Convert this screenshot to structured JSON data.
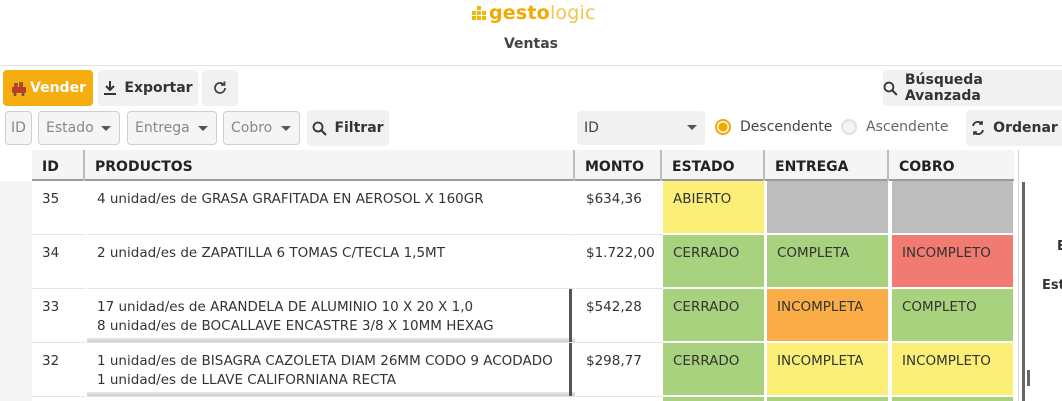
{
  "app": {
    "logo_bold": "gesto",
    "logo_light": "logic",
    "page_title": "Ventas"
  },
  "toolbar": {
    "sell_label": "Vender",
    "export_label": "Exportar",
    "advanced_search_label": "Búsqueda Avanzada"
  },
  "filters": {
    "id_placeholder": "ID",
    "estado_placeholder": "Estado",
    "entrega_placeholder": "Entrega",
    "cobro_placeholder": "Cobro",
    "filter_label": "Filtrar",
    "sort_field": "ID",
    "sort_desc_label": "Descendente",
    "sort_asc_label": "Ascendente",
    "sort_desc_selected": true,
    "order_label": "Ordenar"
  },
  "table": {
    "headers": {
      "id": "ID",
      "productos": "PRODUCTOS",
      "monto": "MONTO",
      "estado": "ESTADO",
      "entrega": "ENTREGA",
      "cobro": "COBRO"
    },
    "rows": [
      {
        "id": "35",
        "productos": [
          "4 unidad/es de GRASA GRAFITADA EN AEROSOL X 160GR"
        ],
        "monto": "$634,36",
        "estado": "ABIERTO",
        "entrega": "",
        "cobro": ""
      },
      {
        "id": "34",
        "productos": [
          "2 unidad/es de ZAPATILLA 6 TOMAS C/TECLA 1,5MT"
        ],
        "monto": "$1.722,00",
        "estado": "CERRADO",
        "entrega": "COMPLETA",
        "cobro": "INCOMPLETO"
      },
      {
        "id": "33",
        "productos": [
          "17 unidad/es de ARANDELA DE ALUMINIO 10 X 20 X 1,0",
          "8 unidad/es de BOCALLAVE ENCASTRE 3/8 X 10MM HEXAG"
        ],
        "monto": "$542,28",
        "estado": "CERRADO",
        "entrega": "INCOMPLETA",
        "cobro": "COMPLETO"
      },
      {
        "id": "32",
        "productos": [
          "1 unidad/es de BISAGRA CAZOLETA DIAM 26MM CODO 9 ACODADO",
          "1 unidad/es de LLAVE CALIFORNIANA RECTA"
        ],
        "monto": "$298,77",
        "estado": "CERRADO",
        "entrega": "INCOMPLETA",
        "cobro": "INCOMPLETO"
      }
    ]
  },
  "side_panel": {
    "clip_1": "E",
    "clip_2": "Est"
  },
  "colors": {
    "accent": "#f6ad0f",
    "status_yellow": "#fbef78",
    "status_green": "#a8d27d",
    "status_red": "#f17b72",
    "status_orange": "#fbad47",
    "status_gray": "#bdbdbd"
  }
}
